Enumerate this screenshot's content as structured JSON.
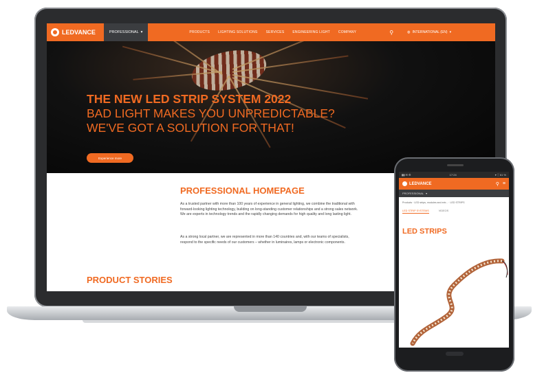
{
  "laptop": {
    "nav": {
      "brand": "LEDVANCE",
      "professional_menu": "PROFESSIONAL",
      "links": [
        "PRODUCTS",
        "LIGHTING SOLUTIONS",
        "SERVICES",
        "ENGINEERING LIGHT",
        "COMPANY"
      ],
      "country": "INTERNATIONAL (EN)"
    },
    "hero": {
      "line1": "THE NEW LED STRIP SYSTEM 2022",
      "line2": "BAD LIGHT MAKES YOU UNPREDICTABLE?",
      "line3": "WE'VE GOT A SOLUTION FOR THAT!",
      "button": "Experience more"
    },
    "content": {
      "title": "PROFESSIONAL HOMEPAGE",
      "paragraph1": "As a trusted partner with more than 100 years of experience in general lighting, we combine the traditional with forward-looking lighting technology, building on long-standing customer relationships and a strong sales network. We are experts in technology trends and the rapidly changing demands for high quality and long lasting light.",
      "paragraph2": "As a strong local partner, we are represented in more than 140 countries and, with our teams of specialists, respond to the specific needs of our customers – whether in luminaires, lamps or electronic components.",
      "stories_title": "PRODUCT STORIES"
    }
  },
  "phone": {
    "status_time": "17:24",
    "status_right": "▾ ░ 61 %",
    "brand": "LEDVANCE",
    "professional_menu": "PROFESSIONAL",
    "breadcrumb": "Products · LED strips, modules and extr... · LED STRIPS",
    "tabs": [
      "LED STRIP SYSTEMS",
      "VIDEOS"
    ],
    "title": "LED STRIPS"
  },
  "colors": {
    "accent": "#f06a22",
    "dark": "#3b3d40"
  }
}
